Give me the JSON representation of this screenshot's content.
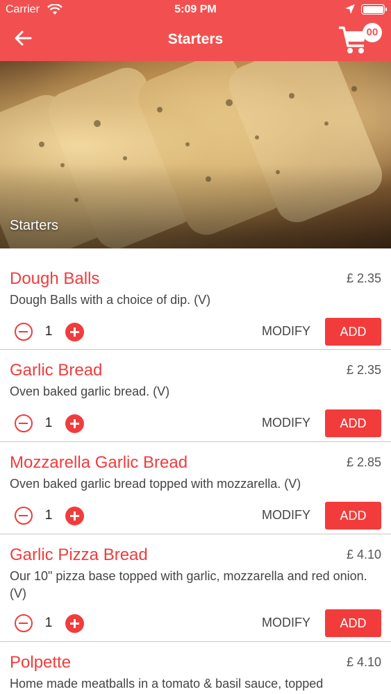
{
  "status_bar": {
    "carrier": "Carrier",
    "time": "5:09 PM",
    "icons": [
      "wifi-icon",
      "location-arrow-icon",
      "battery-icon"
    ]
  },
  "nav": {
    "title": "Starters",
    "back_icon": "arrow-left-icon",
    "cart_icon": "shopping-cart-icon",
    "cart_count": "00"
  },
  "hero": {
    "label": "Starters"
  },
  "colors": {
    "brand": "#f25050",
    "accent": "#f03c3c",
    "text": "#444444"
  },
  "menu": {
    "items": [
      {
        "name": "Dough Balls",
        "price": "£  2.35",
        "description": "Dough Balls with a choice of dip. (V)",
        "quantity": "1",
        "modify_label": "MODIFY",
        "add_label": "ADD"
      },
      {
        "name": "Garlic Bread",
        "price": "£  2.35",
        "description": "Oven baked garlic bread. (V)",
        "quantity": "1",
        "modify_label": "MODIFY",
        "add_label": "ADD"
      },
      {
        "name": "Mozzarella Garlic Bread",
        "price": "£  2.85",
        "description": "Oven baked garlic bread topped with mozzarella. (V)",
        "quantity": "1",
        "modify_label": "MODIFY",
        "add_label": "ADD"
      },
      {
        "name": "Garlic Pizza Bread",
        "price": "£  4.10",
        "description": "Our 10\" pizza base topped with garlic, mozzarella and red onion. (V)",
        "quantity": "1",
        "modify_label": "MODIFY",
        "add_label": "ADD"
      },
      {
        "name": "Polpette",
        "price": "£  4.10",
        "description": "Home made meatballs in a tomato & basil sauce, topped"
      }
    ]
  }
}
